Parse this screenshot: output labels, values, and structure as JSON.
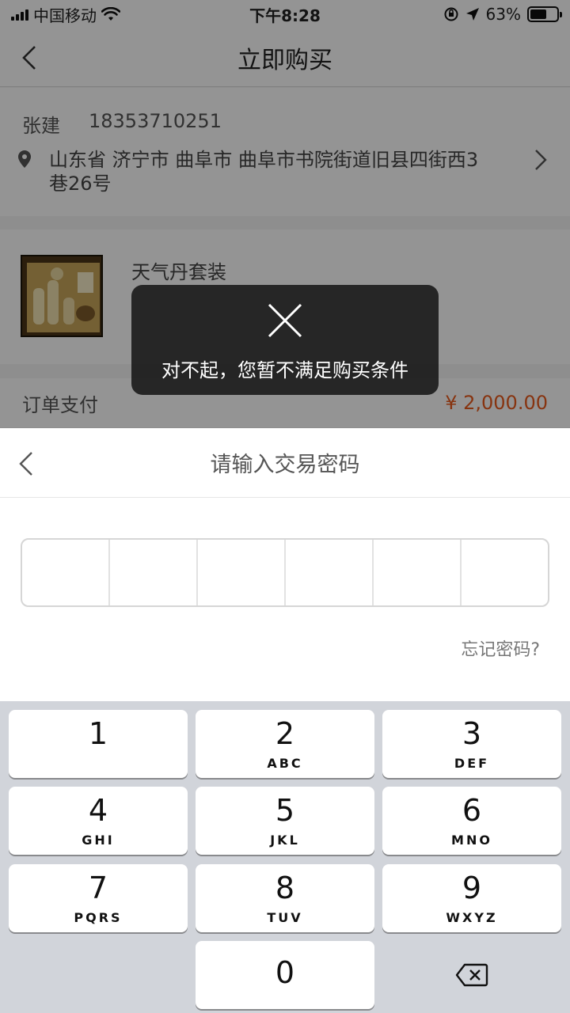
{
  "status_bar": {
    "carrier": "中国移动",
    "time": "下午8:28",
    "battery": "63%",
    "battery_level": 0.63
  },
  "nav": {
    "title": "立即购买"
  },
  "address": {
    "name": "张建",
    "phone": "18353710251",
    "line": "山东省 济宁市 曲阜市 曲阜市书院街道旧县四街西3巷26号"
  },
  "product": {
    "name": "天气丹套装"
  },
  "order": {
    "label": "订单支付",
    "amount": "¥ 2,000.00"
  },
  "toast": {
    "message": "对不起，您暂不满足购买条件"
  },
  "password_sheet": {
    "title": "请输入交易密码",
    "forgot": "忘记密码?"
  },
  "keypad": {
    "keys": [
      {
        "num": "1",
        "letters": ""
      },
      {
        "num": "2",
        "letters": "ABC"
      },
      {
        "num": "3",
        "letters": "DEF"
      },
      {
        "num": "4",
        "letters": "GHI"
      },
      {
        "num": "5",
        "letters": "JKL"
      },
      {
        "num": "6",
        "letters": "MNO"
      },
      {
        "num": "7",
        "letters": "PQRS"
      },
      {
        "num": "8",
        "letters": "TUV"
      },
      {
        "num": "9",
        "letters": "WXYZ"
      },
      {
        "num": "0",
        "letters": ""
      }
    ]
  }
}
